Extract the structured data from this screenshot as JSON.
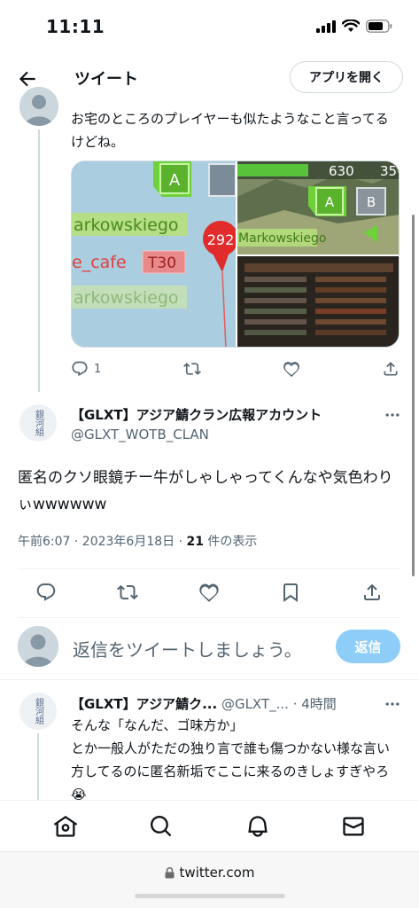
{
  "status_bar": {
    "time": "11:11"
  },
  "header": {
    "title": "ツイート",
    "open_app_label": "アプリを開く"
  },
  "parent_tweet": {
    "text": "お宅のところのプレイヤーも似たようなこと言ってるけどね。",
    "media_texts": {
      "left_a": "A",
      "left_name1": "arkowskiego",
      "left_name2": "e_cafe",
      "left_tag": "T30",
      "left_name3": "arkowskiego",
      "left_marker": "292",
      "right_hp1": "630",
      "right_hp2": "35",
      "right_a": "A",
      "right_b": "B",
      "right_name": "Markowskiego"
    },
    "reply_count": "1"
  },
  "main_tweet": {
    "author_name": "【GLXT】アジア鯖クラン広報アカウント",
    "handle": "@GLXT_WOTB_CLAN",
    "avatar_text": "銀河組",
    "text": "匿名のクソ眼鏡チー牛がしゃしゃってくんなや気色わりぃwwwwww",
    "timestamp": "午前6:07 · 2023年6月18日 · ",
    "views_count": "21",
    "views_label": " 件の表示"
  },
  "composer": {
    "placeholder": "返信をツイートしましょう。",
    "reply_button": "返信"
  },
  "reply_tweet": {
    "author_name": "【GLXT】アジア鯖ク...",
    "handle": "@GLXT_...",
    "time": "· 4時間",
    "avatar_text": "銀河組",
    "text_line1": "そんな「なんだ、ゴ味方か」",
    "text_line2": "とか一般人がただの独り言で誰も傷つかない様な言い方してるのに匿名新垢でここに来るのきしょすぎやろ😭"
  },
  "browser": {
    "url": "twitter.com"
  },
  "colors": {
    "accent": "#1d9bf0",
    "reply_button_disabled": "#8ecdf8",
    "secondary_text": "#536471"
  },
  "icons": [
    "back-arrow-icon",
    "reply-icon",
    "retweet-icon",
    "like-icon",
    "bookmark-icon",
    "share-icon",
    "more-icon",
    "home-icon",
    "search-icon",
    "notifications-icon",
    "messages-icon",
    "lock-icon"
  ]
}
